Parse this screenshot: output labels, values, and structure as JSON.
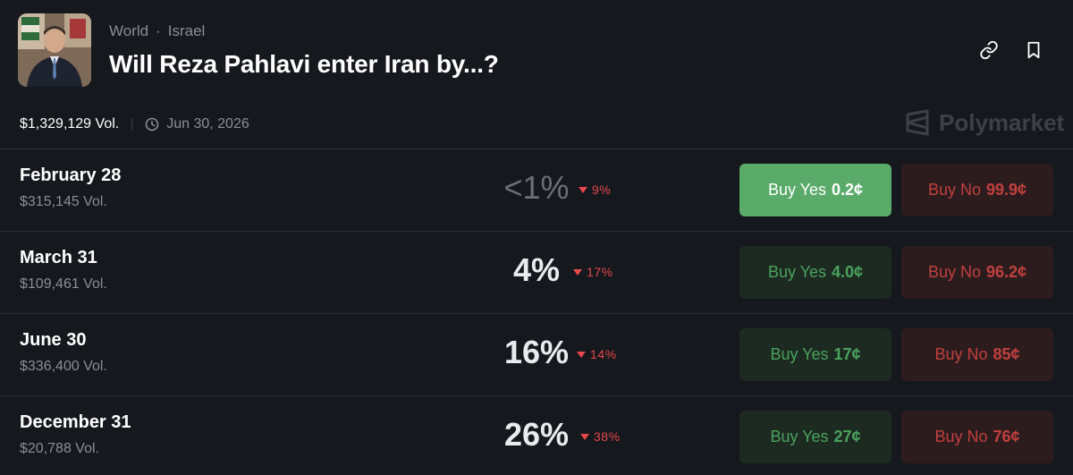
{
  "header": {
    "breadcrumbs": [
      "World",
      "Israel"
    ],
    "title": "Will Reza Pahlavi enter Iran by...?",
    "volume": "$1,329,129 Vol.",
    "end_date": "Jun 30, 2026",
    "brand": "Polymarket"
  },
  "icons": {
    "link": "link-icon",
    "bookmark": "bookmark-icon",
    "clock": "clock-icon",
    "brand_logo": "polymarket-logo-icon"
  },
  "colors": {
    "background": "#15181c",
    "yes_text": "#4aa35c",
    "yes_active_bg": "#5aaa6a",
    "no_text": "#c2403e",
    "change_down": "#e5484d"
  },
  "outcomes": [
    {
      "date": "February 28",
      "volume": "$315,145 Vol.",
      "chance": "<1%",
      "change": "9%",
      "yes_label": "Buy Yes",
      "yes_price": "0.2¢",
      "no_label": "Buy No",
      "no_price": "99.9¢"
    },
    {
      "date": "March 31",
      "volume": "$109,461 Vol.",
      "chance": "4%",
      "change": "17%",
      "yes_label": "Buy Yes",
      "yes_price": "4.0¢",
      "no_label": "Buy No",
      "no_price": "96.2¢"
    },
    {
      "date": "June 30",
      "volume": "$336,400 Vol.",
      "chance": "16%",
      "change": "14%",
      "yes_label": "Buy Yes",
      "yes_price": "17¢",
      "no_label": "Buy No",
      "no_price": "85¢"
    },
    {
      "date": "December 31",
      "volume": "$20,788 Vol.",
      "chance": "26%",
      "change": "38%",
      "yes_label": "Buy Yes",
      "yes_price": "27¢",
      "no_label": "Buy No",
      "no_price": "76¢"
    }
  ]
}
